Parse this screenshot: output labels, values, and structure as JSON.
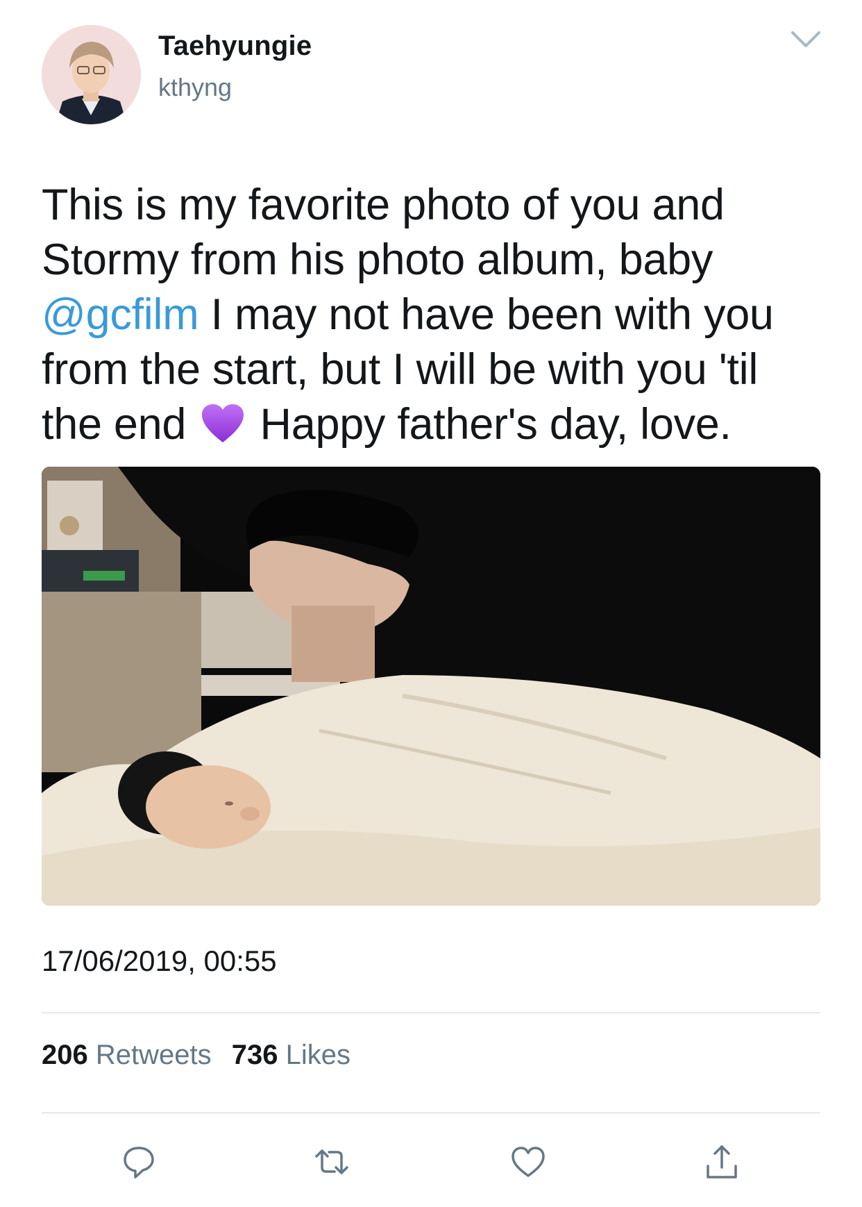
{
  "user": {
    "display_name": "Taehyungie",
    "handle": "kthyng"
  },
  "tweet": {
    "text_part1": "This is my favorite photo of you and Stormy from his photo album, baby ",
    "mention": "@gcfilm",
    "text_part2": " I may not have been with you from the start, but I will be with you 'til the end ",
    "emoji": "purple-heart",
    "text_part3": " Happy father's day, love.",
    "timestamp": "17/06/2019, 00:55"
  },
  "stats": {
    "retweets_count": "206",
    "retweets_label": "Retweets",
    "likes_count": "736",
    "likes_label": "Likes"
  },
  "icons": {
    "menu": "chevron-down-icon",
    "reply": "reply-icon",
    "retweet": "retweet-icon",
    "like": "heart-icon",
    "share": "share-icon"
  },
  "colors": {
    "text": "#14171a",
    "secondary": "#657786",
    "link": "#3a9ad9",
    "emoji": "#a24ae0"
  }
}
